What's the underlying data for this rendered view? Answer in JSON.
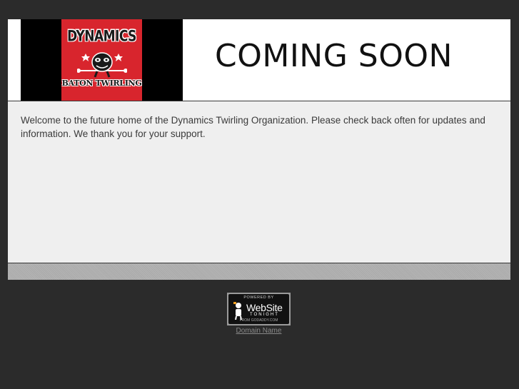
{
  "banner": {
    "logo_top_text": "DYNAMICS",
    "logo_bottom_text": "BATON TWIRLING",
    "headline": "COMING SOON"
  },
  "content": {
    "welcome_text": "Welcome to the future home of the Dynamics Twirling Organization. Please check back often for updates and information. We thank you for your support."
  },
  "footer": {
    "badge_powered_by": "POWERED BY",
    "badge_website": "WebSite",
    "badge_tonight": "TONIGHT",
    "badge_from": "FROM GODADDY.COM",
    "domain_link": "Domain Name"
  },
  "colors": {
    "page_background": "#2b2b2b",
    "logo_red": "#d8252d",
    "content_background": "#efefef"
  }
}
